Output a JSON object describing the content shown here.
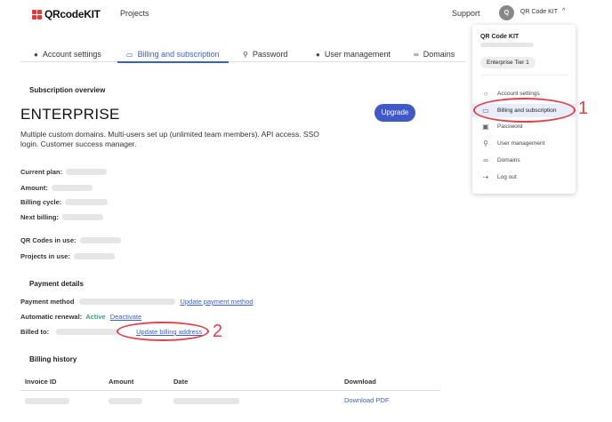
{
  "header": {
    "brand": "QRcodeKIT",
    "nav": [
      "Projects"
    ],
    "support": "Support",
    "avatar_initial": "Q",
    "user_name": "QR Code KIT",
    "caret": "^"
  },
  "tabs": [
    {
      "label": "Account settings",
      "icon": "person-icon"
    },
    {
      "label": "Billing and subscription",
      "icon": "credit-card-icon",
      "active": true
    },
    {
      "label": "Password",
      "icon": "key-icon"
    },
    {
      "label": "User management",
      "icon": "person-icon"
    },
    {
      "label": "Domains",
      "icon": "link-icon"
    }
  ],
  "subscription": {
    "section_title": "Subscription overview",
    "plan": "ENTERPRISE",
    "description": "Multiple custom domains. Multi-users set up (unlimited team members). API access. SSO login. Customer success manager.",
    "upgrade_label": "Upgrade",
    "fields": {
      "current_plan": "Current plan:",
      "amount": "Amount:",
      "billing_cycle": "Billing cycle:",
      "next_billing": "Next billing:",
      "qr_codes": "QR Codes in use:",
      "projects": "Projects in use:"
    }
  },
  "payment": {
    "section_title": "Payment details",
    "method_label": "Payment method",
    "update_method": "Update payment method",
    "renewal_label": "Automatic renewal:",
    "renewal_status": "Active",
    "deactivate": "Deactivate",
    "billed_to_label": "Billed to:",
    "update_address": "Update billing address"
  },
  "billing_history": {
    "section_title": "Billing history",
    "columns": [
      "Invoice ID",
      "Amount",
      "Date",
      "Download"
    ],
    "rows": [
      {
        "download": "Download PDF"
      }
    ]
  },
  "dropdown": {
    "title": "QR Code KIT",
    "badge": "Enterprise Tier 1",
    "items": [
      {
        "label": "Account settings",
        "icon": "person-icon"
      },
      {
        "label": "Billing and subscription",
        "icon": "credit-card-icon",
        "selected": true
      },
      {
        "label": "Password",
        "icon": "lock-icon"
      },
      {
        "label": "User management",
        "icon": "key-icon"
      },
      {
        "label": "Domains",
        "icon": "link-icon"
      },
      {
        "label": "Log out",
        "icon": "logout-icon"
      }
    ]
  },
  "annotations": [
    "1",
    "2"
  ],
  "colors": {
    "accent": "#3a5fd0",
    "upgrade_button": "#3f59c9",
    "active_status": "#3aa37a",
    "annotation": "#e0404a",
    "logo": "#e53935"
  }
}
